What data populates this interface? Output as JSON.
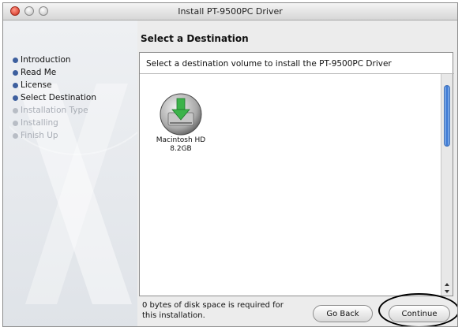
{
  "window": {
    "title": "Install PT-9500PC Driver"
  },
  "sidebar": {
    "steps": [
      {
        "label": "Introduction",
        "enabled": true
      },
      {
        "label": "Read Me",
        "enabled": true
      },
      {
        "label": "License",
        "enabled": true
      },
      {
        "label": "Select Destination",
        "enabled": true
      },
      {
        "label": "Installation Type",
        "enabled": false
      },
      {
        "label": "Installing",
        "enabled": false
      },
      {
        "label": "Finish Up",
        "enabled": false
      }
    ]
  },
  "main": {
    "heading": "Select a Destination",
    "instruction": "Select a destination volume to install the PT-9500PC Driver",
    "volume": {
      "name": "Macintosh HD",
      "size": "8.2GB",
      "icon": "hard-drive-install-icon"
    },
    "space_required": "0 bytes of disk space is required for this installation."
  },
  "buttons": {
    "go_back": "Go Back",
    "continue": "Continue"
  },
  "colors": {
    "accent_blue": "#3d5f9e",
    "install_green": "#3cb34a",
    "scroll_thumb": "#2d6ed1"
  }
}
